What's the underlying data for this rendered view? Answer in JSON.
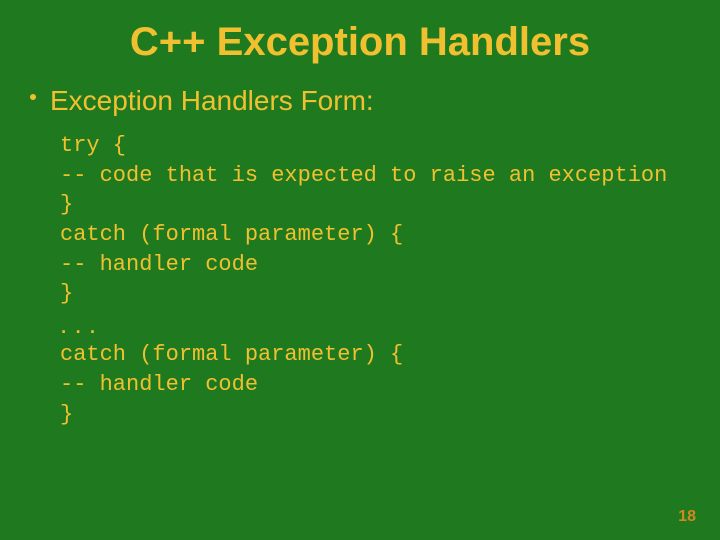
{
  "title": "C++ Exception Handlers",
  "bullet": "Exception Handlers Form:",
  "code1": "try {\n-- code that is expected to raise an exception\n}\ncatch (formal parameter) {\n-- handler code\n}",
  "ellipsis": ". . .",
  "code2": "catch (formal parameter) {\n-- handler code\n}",
  "page": "18"
}
